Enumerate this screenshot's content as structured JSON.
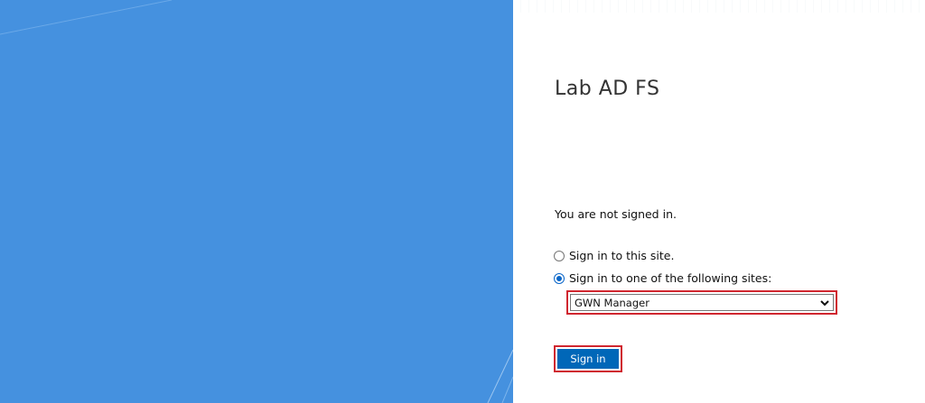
{
  "panel": {
    "title": "Lab AD FS",
    "status_text": "You are not signed in."
  },
  "options": [
    {
      "label": "Sign in to this site.",
      "selected": false
    },
    {
      "label": "Sign in to one of the following sites:",
      "selected": true
    }
  ],
  "site_select": {
    "selected_value": "GWN Manager"
  },
  "signin_button": {
    "label": "Sign in"
  },
  "colors": {
    "illustration_background": "#4591df",
    "button_background": "#0067b8",
    "highlight_border": "#d0262f",
    "radio_checked": "#0a66c9"
  }
}
